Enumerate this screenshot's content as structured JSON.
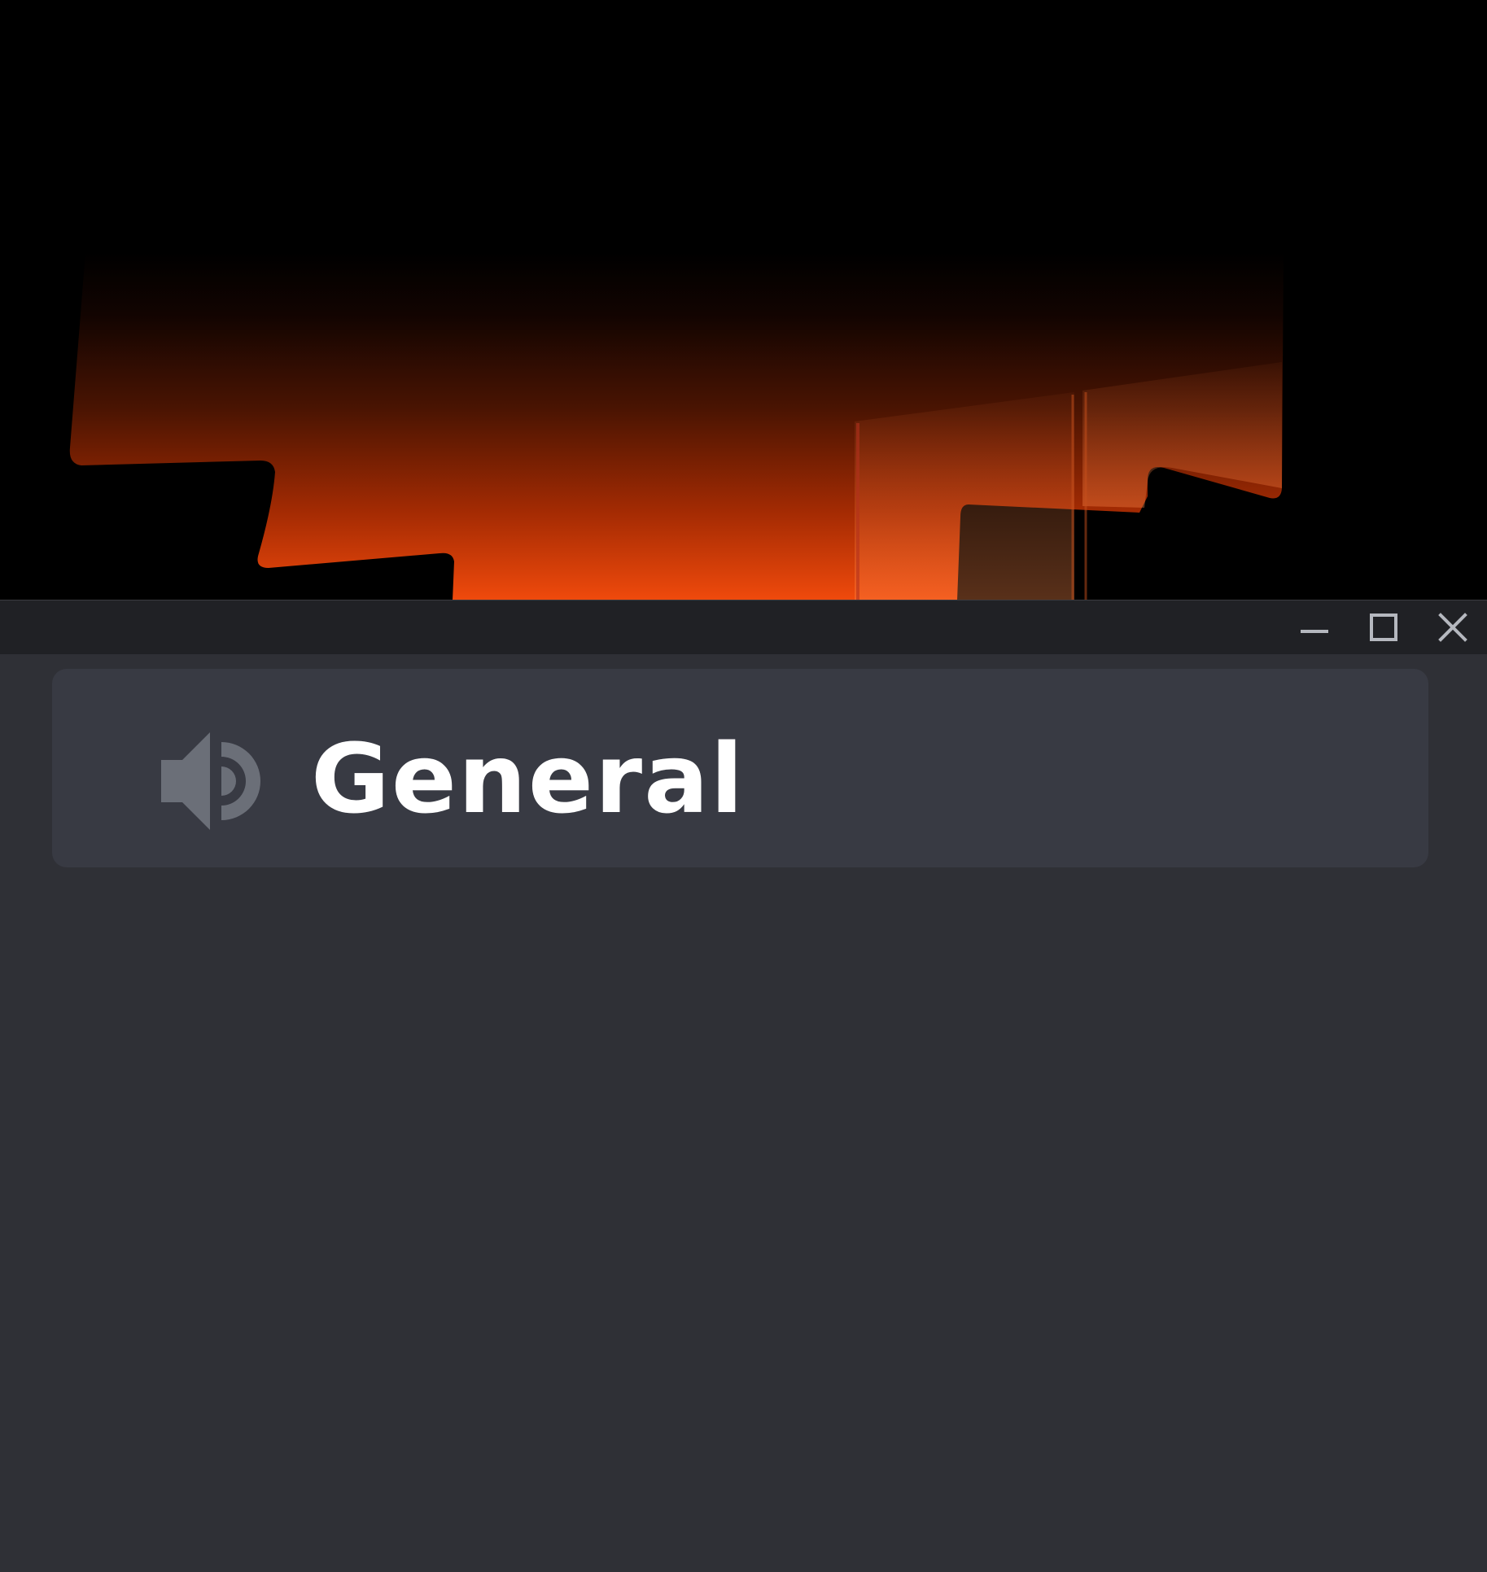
{
  "window": {
    "controls": {
      "minimize_icon": "minimize-icon",
      "maximize_icon": "maximize-icon",
      "close_icon": "close-icon"
    }
  },
  "scene": {
    "description_icon": "sunset-silhouette-art",
    "colors": {
      "sky_top": "#000000",
      "glow_mid": "#8a1e02",
      "glow_bottom": "#f04a0c",
      "silhouette": "#000000"
    }
  },
  "channel": {
    "icon": "speaker-icon",
    "name": "General"
  },
  "colors": {
    "background": "#2f3036",
    "titlebar": "#202125",
    "card": "#383a43",
    "icon_gray": "#6b6f78",
    "text": "#ffffff",
    "window_control": "#b5b8bf"
  }
}
